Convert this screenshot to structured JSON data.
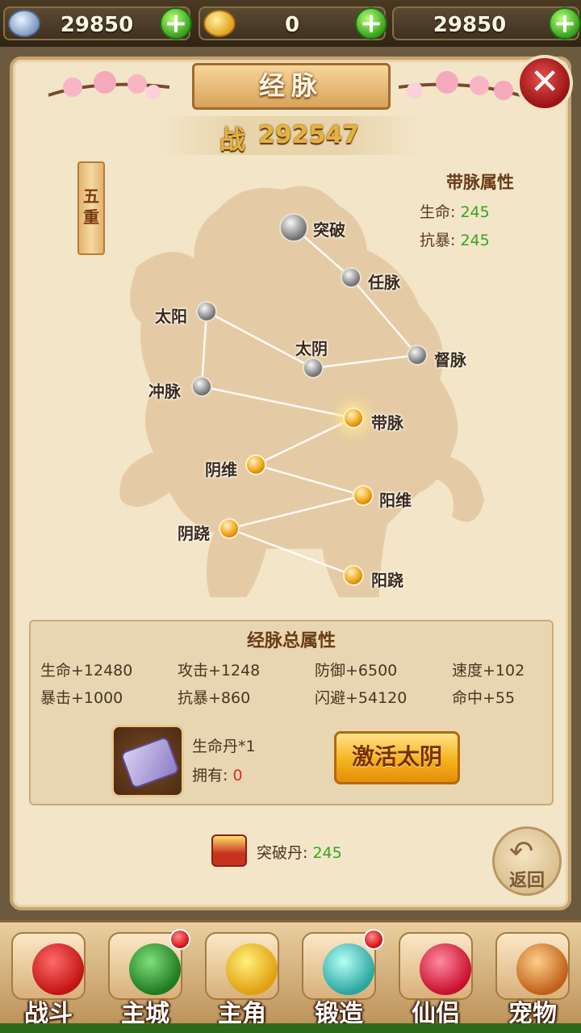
{
  "currency": {
    "silver": "29850",
    "gold": "0",
    "third": "29850"
  },
  "panel": {
    "title": "经脉",
    "power_label": "战",
    "power_value": "292547",
    "tier": "五重"
  },
  "selected_attr": {
    "title": "带脉属性",
    "rows": [
      {
        "label": "生命:",
        "value": "245"
      },
      {
        "label": "抗暴:",
        "value": "245"
      }
    ]
  },
  "meridians": [
    {
      "name": "突破",
      "state": "locked"
    },
    {
      "name": "任脉",
      "state": "locked"
    },
    {
      "name": "太阳",
      "state": "locked"
    },
    {
      "name": "太阴",
      "state": "locked"
    },
    {
      "name": "督脉",
      "state": "locked"
    },
    {
      "name": "冲脉",
      "state": "locked"
    },
    {
      "name": "带脉",
      "state": "active"
    },
    {
      "name": "阴维",
      "state": "active"
    },
    {
      "name": "阳维",
      "state": "active"
    },
    {
      "name": "阴跷",
      "state": "active"
    },
    {
      "name": "阳跷",
      "state": "active"
    }
  ],
  "totals": {
    "title": "经脉总属性",
    "stats": [
      "生命+12480",
      "攻击+1248",
      "防御+6500",
      "速度+102",
      "暴击+1000",
      "抗暴+860",
      "闪避+54120",
      "命中+55"
    ]
  },
  "cost": {
    "item_name": "生命丹*1",
    "owned_label": "拥有:",
    "owned_value": "0",
    "activate_label": "激活太阴"
  },
  "breaker": {
    "label": "突破丹:",
    "value": "245"
  },
  "back_label": "返回",
  "nav": [
    {
      "label": "战斗",
      "badge": false
    },
    {
      "label": "主城",
      "badge": true
    },
    {
      "label": "主角",
      "badge": false
    },
    {
      "label": "锻造",
      "badge": true
    },
    {
      "label": "仙侣",
      "badge": false
    },
    {
      "label": "宠物",
      "badge": false
    }
  ],
  "colors": {
    "accent_gold": "#e6b23a",
    "value_green": "#33a520",
    "warning_red": "#e22a1a"
  }
}
